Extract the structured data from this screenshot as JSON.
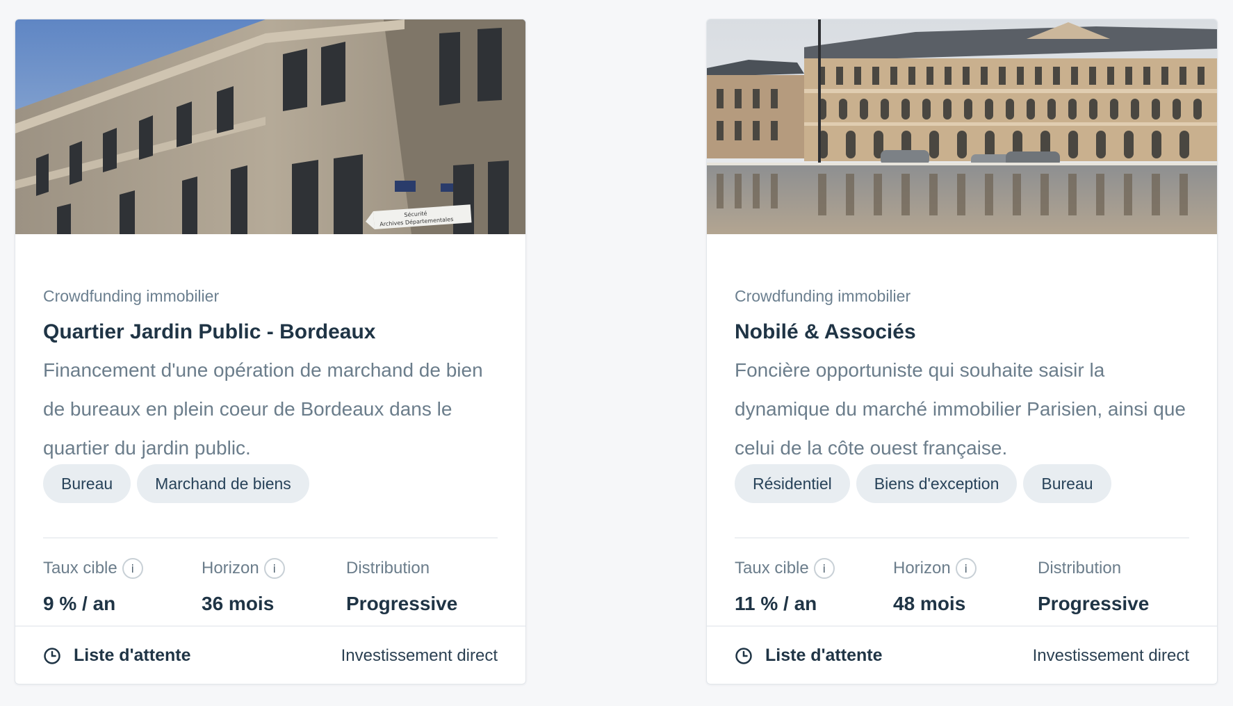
{
  "cards": [
    {
      "category": "Crowdfunding immobilier",
      "title": "Quartier Jardin Public - Bordeaux",
      "description": "Financement d'une opération de marchand de bien de bureaux en plein coeur de Bordeaux dans le quartier du jardin public.",
      "tags": [
        "Bureau",
        "Marchand de biens"
      ],
      "stats": [
        {
          "label": "Taux cible",
          "info": "i",
          "value": "9 % / an"
        },
        {
          "label": "Horizon",
          "info": "i",
          "value": "36 mois"
        },
        {
          "label": "Distribution",
          "value": "Progressive"
        }
      ],
      "status": "Liste d'attente",
      "investment_type": "Investissement direct",
      "image_sign": [
        "Sécurité",
        "Archives Départementales"
      ]
    },
    {
      "category": "Crowdfunding immobilier",
      "title": "Nobilé & Associés",
      "description": "Foncière opportuniste qui souhaite saisir la dynamique du marché immobilier Parisien, ainsi que celui de la côte ouest française.",
      "tags": [
        "Résidentiel",
        "Biens d'exception",
        "Bureau"
      ],
      "stats": [
        {
          "label": "Taux cible",
          "info": "i",
          "value": "11 % / an"
        },
        {
          "label": "Horizon",
          "info": "i",
          "value": "48 mois"
        },
        {
          "label": "Distribution",
          "value": "Progressive"
        }
      ],
      "status": "Liste d'attente",
      "investment_type": "Investissement direct"
    }
  ],
  "icons": {
    "status": "clock-icon",
    "info": "info-circle-icon"
  },
  "colors": {
    "background": "#f6f7f9",
    "title": "#1f3445",
    "muted": "#6b7d8b",
    "tag_bg": "#e8edf1"
  }
}
